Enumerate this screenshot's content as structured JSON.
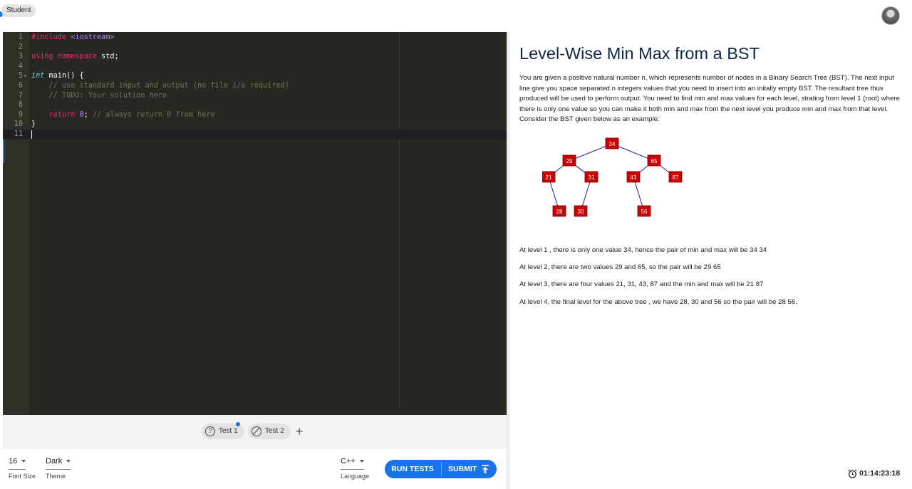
{
  "header": {
    "role_label": "Student",
    "avatar": "user-avatar"
  },
  "editor": {
    "lines": [
      {
        "n": "1"
      },
      {
        "n": "2"
      },
      {
        "n": "3"
      },
      {
        "n": "4"
      },
      {
        "n": "5"
      },
      {
        "n": "6"
      },
      {
        "n": "7"
      },
      {
        "n": "8"
      },
      {
        "n": "9"
      },
      {
        "n": "10"
      },
      {
        "n": "11"
      }
    ],
    "code": {
      "l1_include": "#include",
      "l1_header": "<iostream>",
      "l3_using": "using",
      "l3_namespace": "namespace",
      "l3_std": " std;",
      "l5_int": "int",
      "l5_main": " main() {",
      "l6_comment": "    // use standard input and output (no file i/o required)",
      "l7_comment": "    // TODO: Your solution here",
      "l9_return": "    return",
      "l9_zero": "0",
      "l9_semi": "; ",
      "l9_comment": "// always return 0 from here",
      "l10_brace": "}"
    }
  },
  "tests": {
    "items": [
      {
        "label": "Test 1",
        "icon": "help-circle-icon"
      },
      {
        "label": "Test 2",
        "icon": "block-icon"
      }
    ],
    "add_label": "+"
  },
  "settings": {
    "font_size": {
      "value": "16",
      "caption": "Font Size"
    },
    "theme": {
      "value": "Dark",
      "caption": "Theme"
    },
    "language": {
      "value": "C++",
      "caption": "Language"
    }
  },
  "actions": {
    "run_label": "RUN TESTS",
    "submit_label": "SUBMIT"
  },
  "problem": {
    "title": "Level-Wise Min Max from a BST",
    "description": "You are given a positive natural number n, which represents number of nodes in a Binary Search Tree (BST). The next input line give you space separated n integers values that you need to insert into an initally empty BST. The resultant tree thus produced will be used to perform output. You need to find min and max values for each level, strating from level 1 (root) where there is only one value so you can make it both min and max from the next level you produce min and max from that level. Consider the BST given below as an example:",
    "tree_nodes": [
      "34",
      "29",
      "65",
      "21",
      "31",
      "43",
      "87",
      "28",
      "30",
      "56"
    ],
    "levels": [
      " At level 1 , there is only one value 34, hence the pair of min and max will be 34 34",
      "At level 2, there are two values 29 and 65, so the pair will be 29 65",
      "At level 3, there are four values 21, 31, 43, 87 and the min and max will be 21 87",
      "At level 4, the final level for the above tree , we have 28, 30 and 56 so the pair will be 28 56."
    ]
  },
  "timer": {
    "value": "01:14:23:18"
  },
  "colors": {
    "accent": "#1a73e8",
    "editor_bg": "#272822",
    "node_fill": "#cc0000",
    "title": "#11254a"
  }
}
